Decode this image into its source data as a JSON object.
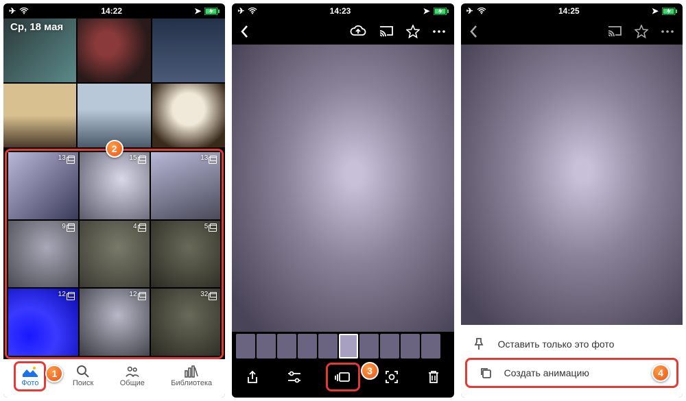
{
  "status": {
    "time1": "14:22",
    "time2": "14:23",
    "time3": "14:25"
  },
  "screen1": {
    "date": "Ср, 18 мая",
    "bursts": [
      {
        "count": "13"
      },
      {
        "count": "15"
      },
      {
        "count": "13"
      },
      {
        "count": "9"
      },
      {
        "count": "4"
      },
      {
        "count": "5"
      },
      {
        "count": "12"
      },
      {
        "count": "12"
      },
      {
        "count": "32"
      }
    ],
    "tabs": {
      "photo": "Фото",
      "search": "Поиск",
      "shared": "Общие",
      "library": "Библиотека"
    }
  },
  "screen3": {
    "keep_only": "Оставить только это фото",
    "create_anim": "Создать анимацию"
  },
  "badges": {
    "b1": "1",
    "b2": "2",
    "b3": "3",
    "b4": "4"
  }
}
